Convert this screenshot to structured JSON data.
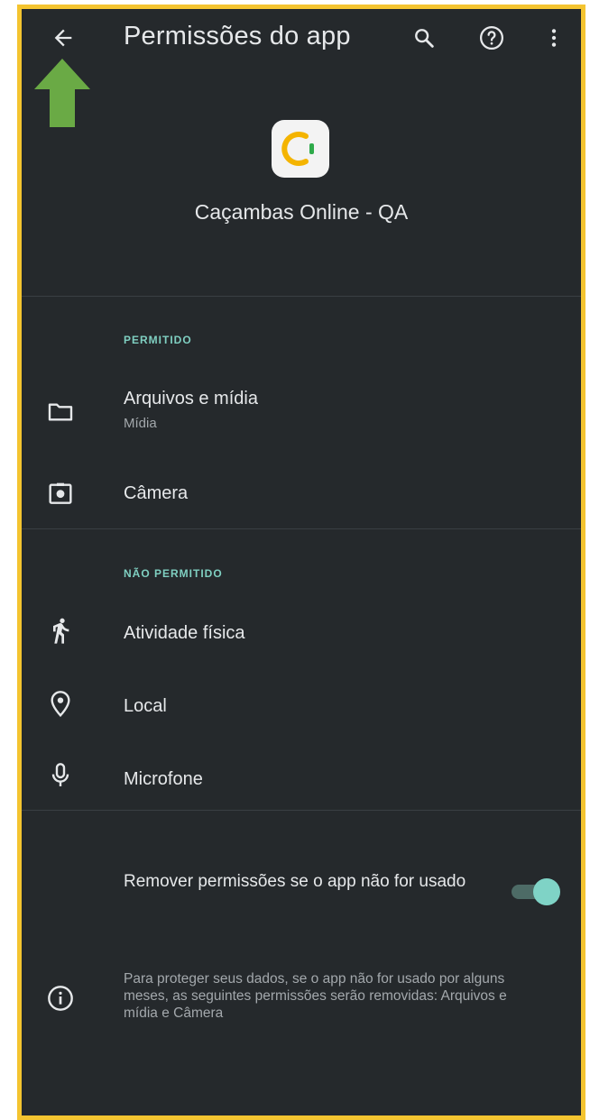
{
  "appbar": {
    "title": "Permissões do app",
    "back_icon": "arrow-back-icon",
    "search_icon": "search-icon",
    "help_icon": "help-icon",
    "more_icon": "more-vert-icon"
  },
  "annotation": {
    "icon": "green-up-arrow",
    "color": "#6aaa45"
  },
  "app": {
    "name": "Caçambas Online - QA",
    "icon": "app-logo-icon"
  },
  "allowed": {
    "header": "PERMITIDO",
    "items": [
      {
        "label": "Arquivos e mídia",
        "sublabel": "Mídia",
        "icon": "folder-icon"
      },
      {
        "label": "Câmera",
        "icon": "camera-icon"
      }
    ]
  },
  "not_allowed": {
    "header": "NÃO PERMITIDO",
    "items": [
      {
        "label": "Atividade física",
        "icon": "walking-icon"
      },
      {
        "label": "Local",
        "icon": "location-icon"
      },
      {
        "label": "Microfone",
        "icon": "microphone-icon"
      }
    ]
  },
  "auto_revoke": {
    "label": "Remover permissões se o app não for usado",
    "enabled": true
  },
  "info": {
    "text": "Para proteger seus dados, se o app não for usado por alguns meses, as seguintes permissões serão removidas: Arquivos e mídia e Câmera",
    "icon": "info-icon"
  },
  "colors": {
    "background": "#25292c",
    "accent": "#7fcfc1",
    "border": "#f4c430"
  }
}
